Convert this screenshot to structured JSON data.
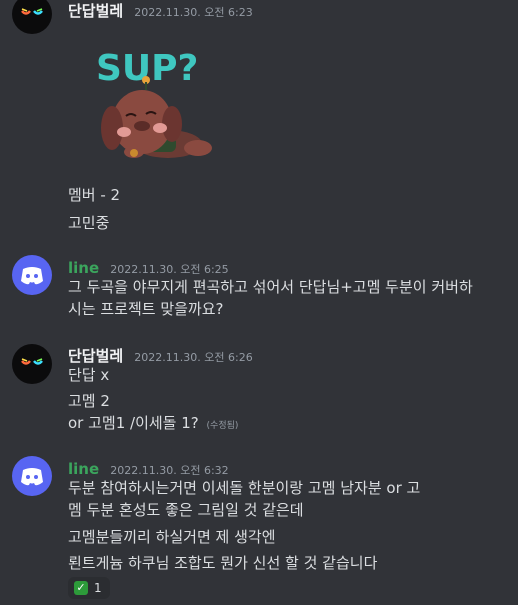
{
  "messages": [
    {
      "author": "단답벌레",
      "timestamp": "2022.11.30. 오전 6:23",
      "sticker": "SUP?",
      "lines": [
        "멤버 - 2",
        "고민중"
      ]
    },
    {
      "author": "line",
      "timestamp": "2022.11.30. 오전 6:25",
      "text": "그 두곡을 야무지게 편곡하고 섞어서 단답님+고멤 두분이 커버하시는 프로젝트 맞을까요?"
    },
    {
      "author": "단답벌레",
      "timestamp": "2022.11.30. 오전 6:26",
      "lines": [
        "단답 x",
        "고멤 2",
        "or 고멤1 /이세돌 1?"
      ],
      "edited": "(수정됨)"
    },
    {
      "author": "line",
      "timestamp": "2022.11.30. 오전 6:32",
      "lines": [
        "두분 참여하시는거면 이세돌 한분이랑 고멤 남자분 or 고",
        "멤 두분 혼성도 좋은 그림일 것 같은데",
        "고멤분들끼리 하실거면 제 생각엔",
        "뢴트게늄 하쿠님 조합도 뭔가 신선 할 것 같습니다"
      ],
      "reaction": {
        "emoji": "check-mark-button",
        "count": "1"
      }
    }
  ],
  "colors": {
    "background": "#313338",
    "username_white": "#f2f3f5",
    "username_green": "#3ba55d",
    "discord_blurple": "#5865f2"
  }
}
